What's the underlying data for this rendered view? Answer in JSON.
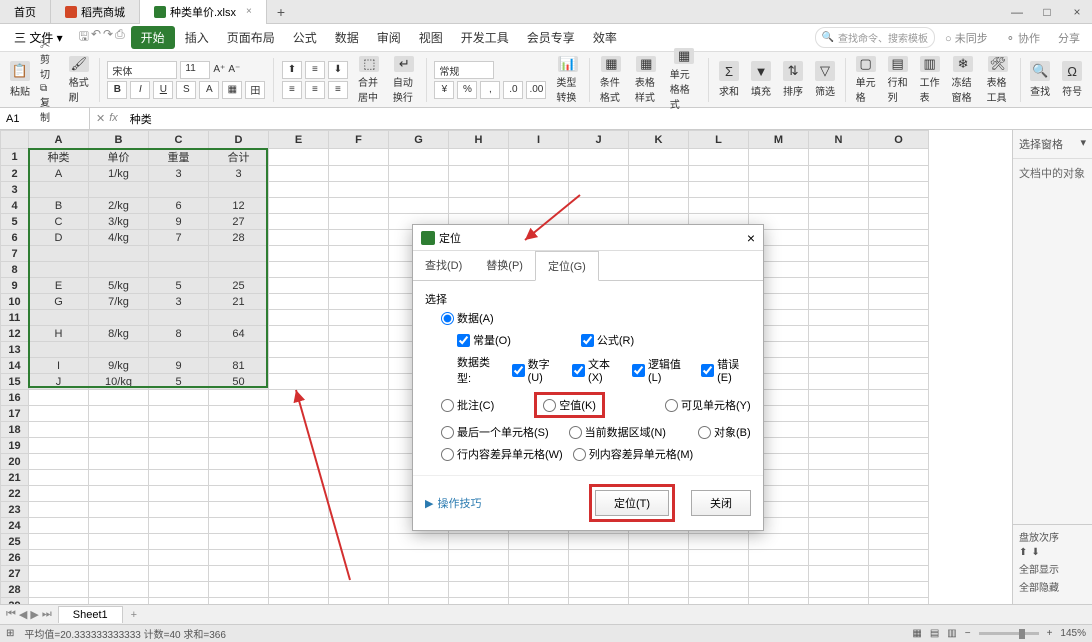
{
  "tabs": {
    "home": "首页",
    "t1": "稻壳商城",
    "t2": "种类单价.xlsx"
  },
  "win": {
    "min": "—",
    "max": "□",
    "close": "×"
  },
  "menu": {
    "file": "三 文件 ▾",
    "items": [
      "开始",
      "插入",
      "页面布局",
      "公式",
      "数据",
      "审阅",
      "视图",
      "开发工具",
      "会员专享",
      "效率"
    ],
    "search_ph": "查找命令、搜索模板",
    "unsync": "○ 未同步",
    "coop": "⚬ 协作",
    "share": "分享"
  },
  "ribbon": {
    "paste": "粘贴",
    "cut": "剪切",
    "copy": "复制",
    "fmtpaint": "格式刷",
    "font": "宋体",
    "size": "11",
    "mergefmt": "合并居中",
    "wrap": "自动换行",
    "general": "常规",
    "condfmt": "条件格式",
    "cellstyle": "表格样式",
    "cellfmt": "单元格格式",
    "sum": "求和",
    "fill": "填充",
    "sort": "排序",
    "filter": "筛选",
    "cell": "单元格",
    "rowcol": "行和列",
    "ws": "工作表",
    "freeze": "冻结窗格",
    "tools": "表格工具",
    "find": "查找",
    "symbol": "符号"
  },
  "refbar": {
    "cell": "A1",
    "val": "种类"
  },
  "cols": [
    "A",
    "B",
    "C",
    "D",
    "E",
    "F",
    "G",
    "H",
    "I",
    "J",
    "K",
    "L",
    "M",
    "N",
    "O"
  ],
  "headers": [
    "种类",
    "单价",
    "重量",
    "合计"
  ],
  "data": [
    [
      "A",
      "1/kg",
      "3",
      "3"
    ],
    [
      "",
      "",
      "",
      ""
    ],
    [
      "B",
      "2/kg",
      "6",
      "12"
    ],
    [
      "C",
      "3/kg",
      "9",
      "27"
    ],
    [
      "D",
      "4/kg",
      "7",
      "28"
    ],
    [
      "",
      "",
      "",
      ""
    ],
    [
      "",
      "",
      "",
      ""
    ],
    [
      "E",
      "5/kg",
      "5",
      "25"
    ],
    [
      "G",
      "7/kg",
      "3",
      "21"
    ],
    [
      "",
      "",
      "",
      ""
    ],
    [
      "H",
      "8/kg",
      "8",
      "64"
    ],
    [
      "",
      "",
      "",
      ""
    ],
    [
      "I",
      "9/kg",
      "9",
      "81"
    ],
    [
      "J",
      "10/kg",
      "5",
      "50"
    ]
  ],
  "rp": {
    "title": "选择窗格",
    "body": "文档中的对象",
    "order": "盘放次序",
    "showall": "全部显示",
    "hideall": "全部隐藏"
  },
  "dialog": {
    "title": "定位",
    "tabs": [
      "查找(D)",
      "替换(P)",
      "定位(G)"
    ],
    "select_label": "选择",
    "data": "数据(A)",
    "const": "常量(O)",
    "formula": "公式(R)",
    "dtype": "数据类型:",
    "num": "数字(U)",
    "text": "文本(X)",
    "logic": "逻辑值(L)",
    "err": "错误(E)",
    "comment": "批注(C)",
    "blank": "空值(K)",
    "visible": "可见单元格(Y)",
    "lastcell": "最后一个单元格(S)",
    "curdata": "当前数据区域(N)",
    "obj": "对象(B)",
    "rowdiff": "行内容差异单元格(W)",
    "coldiff": "列内容差异单元格(M)",
    "tips": "操作技巧",
    "ok": "定位(T)",
    "cancel": "关闭"
  },
  "sheet": {
    "name": "Sheet1"
  },
  "status": {
    "left": "平均值=20.333333333333  计数=40  求和=366",
    "zoom": "145%"
  }
}
